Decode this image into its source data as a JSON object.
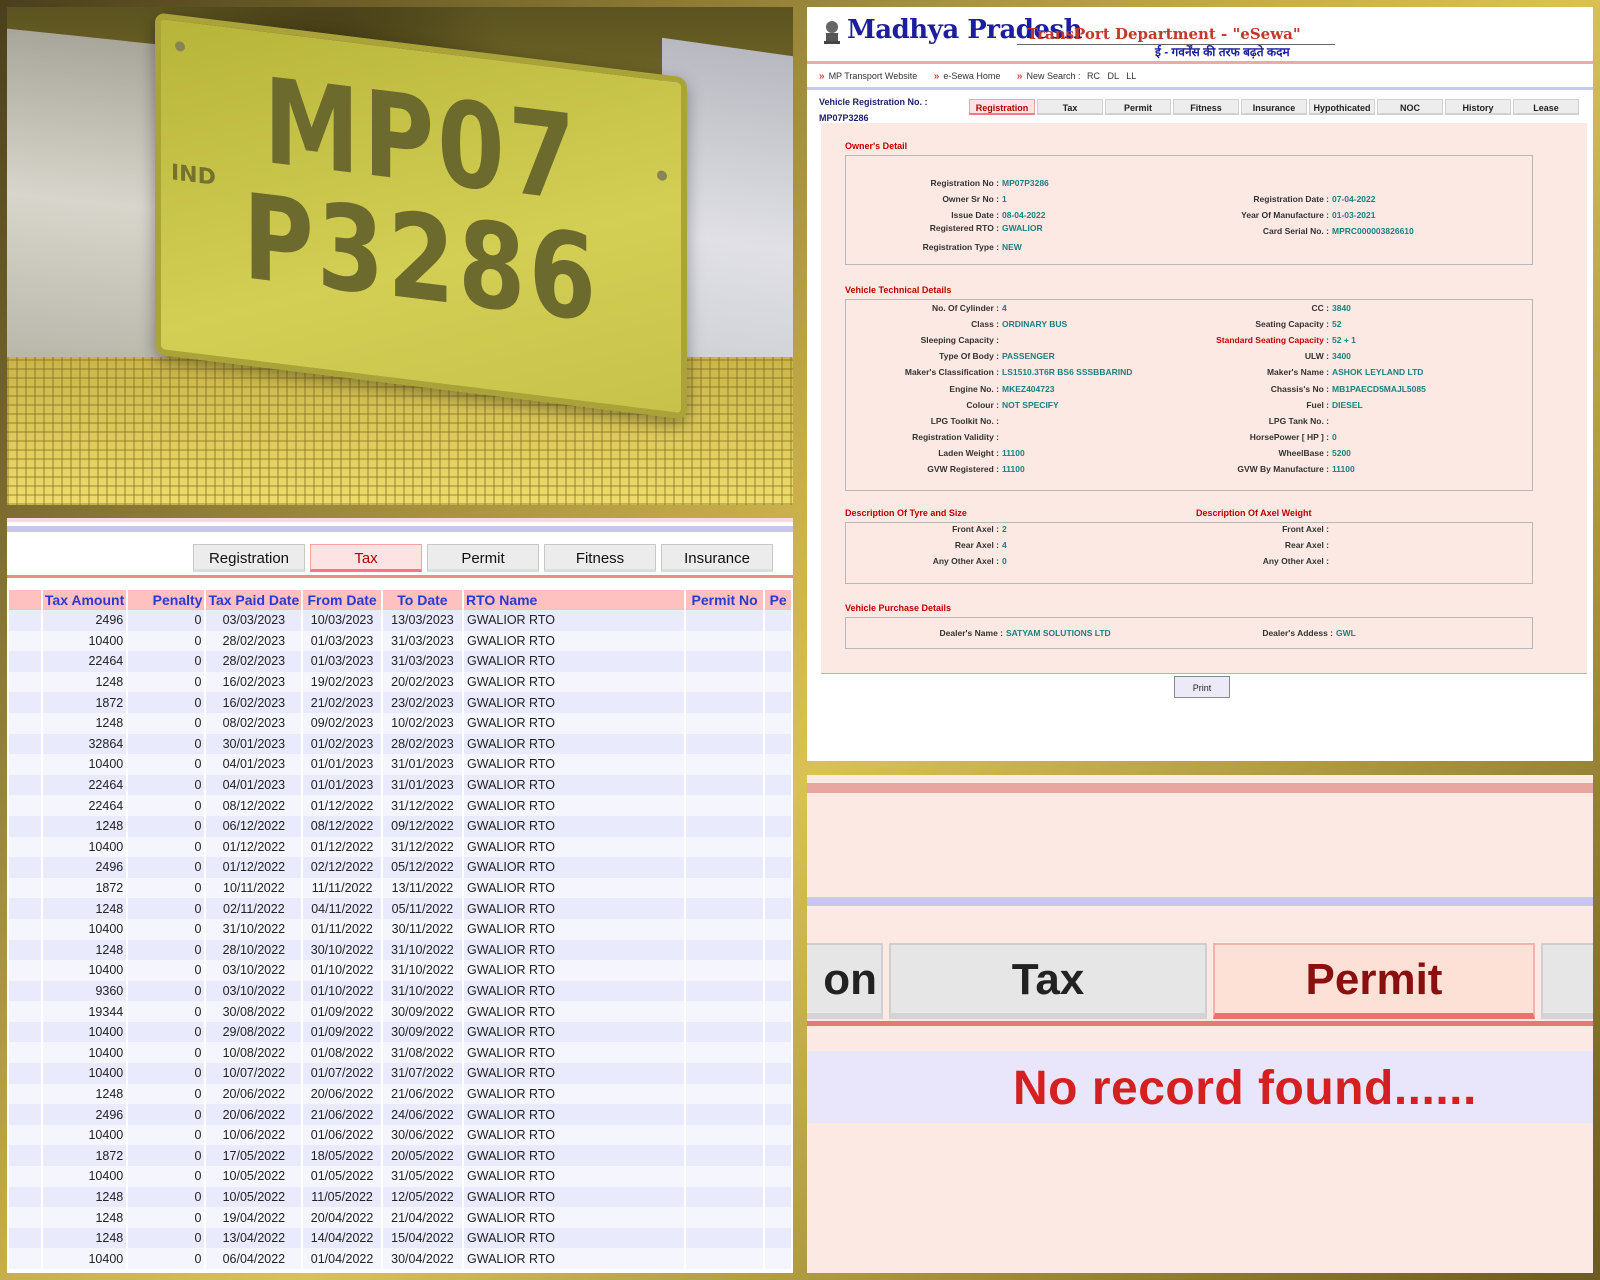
{
  "photo": {
    "plate_line1": "MP07",
    "plate_line2": "P3286",
    "plate_prefix": "IND"
  },
  "tax_panel": {
    "tabs": [
      {
        "label": "Registration",
        "active": false
      },
      {
        "label": "Tax",
        "active": true
      },
      {
        "label": "Permit",
        "active": false
      },
      {
        "label": "Fitness",
        "active": false
      },
      {
        "label": "Insurance",
        "active": false
      }
    ],
    "columns": [
      "",
      "Tax Amount",
      "Penalty",
      "Tax Paid Date",
      "From Date",
      "To Date",
      "RTO Name",
      "Permit No",
      "Pe"
    ],
    "rows": [
      [
        "2496",
        "0",
        "03/03/2023",
        "10/03/2023",
        "13/03/2023",
        "GWALIOR RTO"
      ],
      [
        "10400",
        "0",
        "28/02/2023",
        "01/03/2023",
        "31/03/2023",
        "GWALIOR RTO"
      ],
      [
        "22464",
        "0",
        "28/02/2023",
        "01/03/2023",
        "31/03/2023",
        "GWALIOR RTO"
      ],
      [
        "1248",
        "0",
        "16/02/2023",
        "19/02/2023",
        "20/02/2023",
        "GWALIOR RTO"
      ],
      [
        "1872",
        "0",
        "16/02/2023",
        "21/02/2023",
        "23/02/2023",
        "GWALIOR RTO"
      ],
      [
        "1248",
        "0",
        "08/02/2023",
        "09/02/2023",
        "10/02/2023",
        "GWALIOR RTO"
      ],
      [
        "32864",
        "0",
        "30/01/2023",
        "01/02/2023",
        "28/02/2023",
        "GWALIOR RTO"
      ],
      [
        "10400",
        "0",
        "04/01/2023",
        "01/01/2023",
        "31/01/2023",
        "GWALIOR RTO"
      ],
      [
        "22464",
        "0",
        "04/01/2023",
        "01/01/2023",
        "31/01/2023",
        "GWALIOR RTO"
      ],
      [
        "22464",
        "0",
        "08/12/2022",
        "01/12/2022",
        "31/12/2022",
        "GWALIOR RTO"
      ],
      [
        "1248",
        "0",
        "06/12/2022",
        "08/12/2022",
        "09/12/2022",
        "GWALIOR RTO"
      ],
      [
        "10400",
        "0",
        "01/12/2022",
        "01/12/2022",
        "31/12/2022",
        "GWALIOR RTO"
      ],
      [
        "2496",
        "0",
        "01/12/2022",
        "02/12/2022",
        "05/12/2022",
        "GWALIOR RTO"
      ],
      [
        "1872",
        "0",
        "10/11/2022",
        "11/11/2022",
        "13/11/2022",
        "GWALIOR RTO"
      ],
      [
        "1248",
        "0",
        "02/11/2022",
        "04/11/2022",
        "05/11/2022",
        "GWALIOR RTO"
      ],
      [
        "10400",
        "0",
        "31/10/2022",
        "01/11/2022",
        "30/11/2022",
        "GWALIOR RTO"
      ],
      [
        "1248",
        "0",
        "28/10/2022",
        "30/10/2022",
        "31/10/2022",
        "GWALIOR RTO"
      ],
      [
        "10400",
        "0",
        "03/10/2022",
        "01/10/2022",
        "31/10/2022",
        "GWALIOR RTO"
      ],
      [
        "9360",
        "0",
        "03/10/2022",
        "01/10/2022",
        "31/10/2022",
        "GWALIOR RTO"
      ],
      [
        "19344",
        "0",
        "30/08/2022",
        "01/09/2022",
        "30/09/2022",
        "GWALIOR RTO"
      ],
      [
        "10400",
        "0",
        "29/08/2022",
        "01/09/2022",
        "30/09/2022",
        "GWALIOR RTO"
      ],
      [
        "10400",
        "0",
        "10/08/2022",
        "01/08/2022",
        "31/08/2022",
        "GWALIOR RTO"
      ],
      [
        "10400",
        "0",
        "10/07/2022",
        "01/07/2022",
        "31/07/2022",
        "GWALIOR RTO"
      ],
      [
        "1248",
        "0",
        "20/06/2022",
        "20/06/2022",
        "21/06/2022",
        "GWALIOR RTO"
      ],
      [
        "2496",
        "0",
        "20/06/2022",
        "21/06/2022",
        "24/06/2022",
        "GWALIOR RTO"
      ],
      [
        "10400",
        "0",
        "10/06/2022",
        "01/06/2022",
        "30/06/2022",
        "GWALIOR RTO"
      ],
      [
        "1872",
        "0",
        "17/05/2022",
        "18/05/2022",
        "20/05/2022",
        "GWALIOR RTO"
      ],
      [
        "10400",
        "0",
        "10/05/2022",
        "01/05/2022",
        "31/05/2022",
        "GWALIOR RTO"
      ],
      [
        "1248",
        "0",
        "10/05/2022",
        "11/05/2022",
        "12/05/2022",
        "GWALIOR RTO"
      ],
      [
        "1248",
        "0",
        "19/04/2022",
        "20/04/2022",
        "21/04/2022",
        "GWALIOR RTO"
      ],
      [
        "1248",
        "0",
        "13/04/2022",
        "14/04/2022",
        "15/04/2022",
        "GWALIOR RTO"
      ],
      [
        "10400",
        "0",
        "06/04/2022",
        "01/04/2022",
        "30/04/2022",
        "GWALIOR RTO"
      ]
    ]
  },
  "reg_panel": {
    "title": "Madhya Pradesh",
    "subtitle": "TransPort Department - \"eSewa\"",
    "hindi_tagline": "ई - गवर्नेंस की तरफ बढ़ते कदम",
    "nav": {
      "mp_site": "MP Transport Website",
      "home": "e-Sewa Home",
      "new_search": "New Search :",
      "rc": "RC",
      "dl": "DL",
      "ll": "LL"
    },
    "vehicle_label": "Vehicle Registration No. :",
    "vehicle_no": "MP07P3286",
    "tabs": [
      {
        "label": "Registration",
        "active": true
      },
      {
        "label": "Tax",
        "active": false
      },
      {
        "label": "Permit",
        "active": false
      },
      {
        "label": "Fitness",
        "active": false
      },
      {
        "label": "Insurance",
        "active": false
      },
      {
        "label": "Hypothicated",
        "active": false
      },
      {
        "label": "NOC",
        "active": false
      },
      {
        "label": "History",
        "active": false
      },
      {
        "label": "Lease",
        "active": false
      }
    ],
    "owner_title": "Owner's Detail",
    "owner_left": [
      {
        "k": "Registration No :",
        "v": "MP07P3286"
      },
      {
        "k": "Owner Sr No :",
        "v": "1"
      },
      {
        "k": "Issue Date :",
        "v": "08-04-2022"
      },
      {
        "k": "Registered RTO :",
        "v": "GWALIOR"
      },
      {
        "k": "Registration Type :",
        "v": "NEW"
      }
    ],
    "owner_right": [
      {
        "k": "Registration Date :",
        "v": "07-04-2022"
      },
      {
        "k": "Year Of Manufacture :",
        "v": "01-03-2021"
      },
      {
        "k": "Card Serial No. :",
        "v": "MPRC000003826610"
      }
    ],
    "tech_title": "Vehicle Technical Details",
    "tech_left": [
      {
        "k": "No. Of Cylinder :",
        "v": "4"
      },
      {
        "k": "Class :",
        "v": "ORDINARY BUS"
      },
      {
        "k": "Sleeping Capacity :",
        "v": ""
      },
      {
        "k": "Type Of Body :",
        "v": "PASSENGER"
      },
      {
        "k": "Maker's Classification :",
        "v": "LS1510.3T6R BS6 SSSBBARIND"
      },
      {
        "k": "Engine No. :",
        "v": "MKEZ404723"
      },
      {
        "k": "Colour :",
        "v": "NOT SPECIFY"
      },
      {
        "k": "LPG Toolkit No. :",
        "v": ""
      },
      {
        "k": "Registration Validity :",
        "v": ""
      },
      {
        "k": "Laden Weight :",
        "v": "11100"
      },
      {
        "k": "GVW Registered :",
        "v": "11100"
      }
    ],
    "tech_right": [
      {
        "k": "CC :",
        "v": "3840"
      },
      {
        "k": "Seating Capacity :",
        "v": "52"
      },
      {
        "k": "Standard Seating Capacity :",
        "v": "52 + 1"
      },
      {
        "k": "ULW :",
        "v": "3400"
      },
      {
        "k": "Maker's Name :",
        "v": "ASHOK LEYLAND LTD"
      },
      {
        "k": "Chassis's No :",
        "v": "MB1PAECD5MAJL5085"
      },
      {
        "k": "Fuel :",
        "v": "DIESEL"
      },
      {
        "k": "LPG Tank No. :",
        "v": ""
      },
      {
        "k": "HorsePower [ HP ] :",
        "v": "0"
      },
      {
        "k": "WheelBase :",
        "v": "5200"
      },
      {
        "k": "GVW By Manufacture :",
        "v": "11100"
      }
    ],
    "tyre_title": "Description Of Tyre and Size",
    "axel_title": "Description Of Axel Weight",
    "tyre_left": [
      {
        "k": "Front Axel :",
        "v": "2"
      },
      {
        "k": "Rear Axel :",
        "v": "4"
      },
      {
        "k": "Any Other Axel :",
        "v": "0"
      }
    ],
    "tyre_right": [
      {
        "k": "Front Axel :",
        "v": ""
      },
      {
        "k": "Rear Axel :",
        "v": ""
      },
      {
        "k": "Any Other Axel :",
        "v": ""
      }
    ],
    "purchase_title": "Vehicle Purchase Details",
    "dealer_name_k": "Dealer's Name :",
    "dealer_name_v": "SATYAM SOLUTIONS LTD",
    "dealer_addr_k": "Dealer's Addess :",
    "dealer_addr_v": "GWL",
    "print_label": "Print"
  },
  "permit_panel": {
    "tab_partial": "on",
    "tab_tax": "Tax",
    "tab_permit": "Permit",
    "message": "No record found......"
  }
}
